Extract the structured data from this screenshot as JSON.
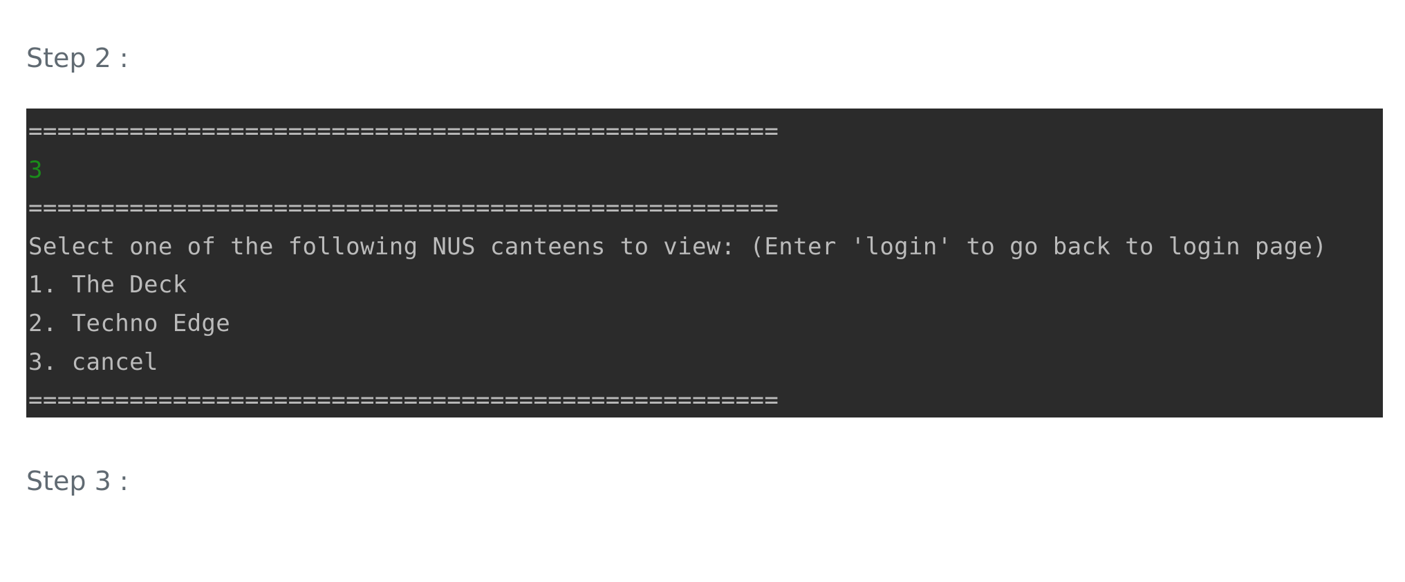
{
  "headings": {
    "step2": "Step 2 :",
    "step3": "Step 3 :"
  },
  "terminal": {
    "lines": [
      "====================================================",
      "3",
      "====================================================",
      "Select one of the following NUS canteens to view: (Enter 'login' to go back to login page)",
      "1. The Deck",
      "2. Techno Edge",
      "3. cancel",
      "===================================================="
    ],
    "colors": {
      "background": "#2b2b2b",
      "text": "#bbbbbb",
      "user_input": "#1a8c1a"
    }
  }
}
